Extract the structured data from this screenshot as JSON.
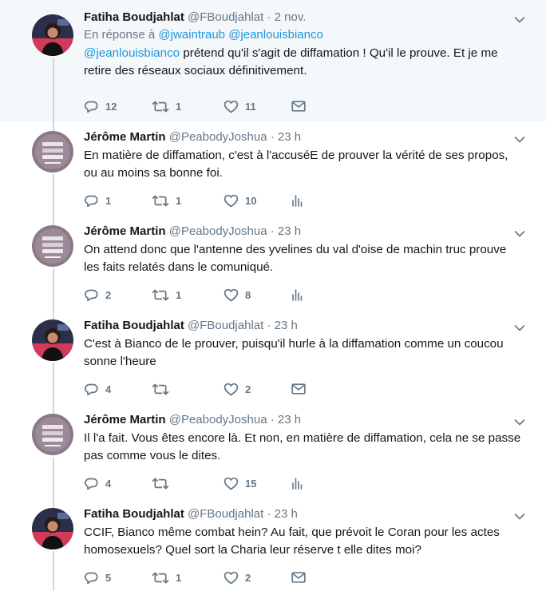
{
  "colors": {
    "link": "#1b95e0",
    "muted": "#657786",
    "rail": "#ccd6dd",
    "highlight_bg": "#f5f8fa"
  },
  "tweets": [
    {
      "name": "Fatiha Boudjahlat",
      "handle": "@FBoudjahlat",
      "time": "2 nov.",
      "reply_prefix": "En réponse à",
      "reply_to_1": "@jwaintraub",
      "reply_to_2": "@jeanlouisbianco",
      "mention": "@jeanlouisbianco",
      "text": " prétend qu'il s'agit de diffamation ! Qu'il le prouve. Et je me retire des réseaux sociaux définitivement.",
      "replies": "12",
      "retweets": "1",
      "likes": "11",
      "extra_icon": "envelope-icon",
      "avatar": "avatar-photo"
    },
    {
      "name": "Jérôme Martin",
      "handle": "@PeabodyJoshua",
      "time": "23 h",
      "text": "En matière de diffamation, c'est à l'accuséE de prouver la vérité de ses propos, ou au moins sa bonne foi.",
      "replies": "1",
      "retweets": "1",
      "likes": "10",
      "extra_icon": "analytics-icon",
      "avatar": "avatar-logo"
    },
    {
      "name": "Jérôme Martin",
      "handle": "@PeabodyJoshua",
      "time": "23 h",
      "text": "On attend donc que l'antenne des yvelines du val d'oise de machin truc prouve les faits relatés dans le comuniqué.",
      "replies": "2",
      "retweets": "1",
      "likes": "8",
      "extra_icon": "analytics-icon",
      "avatar": "avatar-logo"
    },
    {
      "name": "Fatiha Boudjahlat",
      "handle": "@FBoudjahlat",
      "time": "23 h",
      "text": "C'est à Bianco de le prouver, puisqu'il hurle à la diffamation comme un coucou sonne l'heure",
      "replies": "4",
      "retweets": "",
      "likes": "2",
      "extra_icon": "envelope-icon",
      "avatar": "avatar-photo"
    },
    {
      "name": "Jérôme Martin",
      "handle": "@PeabodyJoshua",
      "time": "23 h",
      "text": "Il l'a fait. Vous êtes encore là. Et non, en matière de diffamation, cela ne se passe pas comme vous le dites.",
      "replies": "4",
      "retweets": "",
      "likes": "15",
      "extra_icon": "analytics-icon",
      "avatar": "avatar-logo"
    },
    {
      "name": "Fatiha Boudjahlat",
      "handle": "@FBoudjahlat",
      "time": "23 h",
      "text": "CCIF, Bianco même combat hein? Au fait, que prévoit le Coran pour les actes homosexuels? Quel sort la Charia leur réserve t elle dites moi?",
      "replies": "5",
      "retweets": "1",
      "likes": "2",
      "extra_icon": "envelope-icon",
      "avatar": "avatar-photo"
    }
  ]
}
